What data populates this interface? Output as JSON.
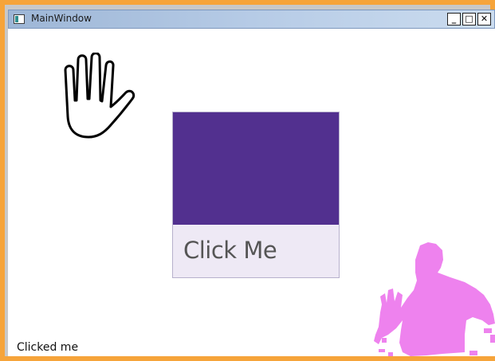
{
  "window": {
    "title": "MainWindow",
    "buttons": {
      "minimize": "_",
      "maximize": "□",
      "close": "✕"
    },
    "frame_color": "#f6a43a"
  },
  "main": {
    "tile": {
      "label": "Click Me",
      "accent_color": "#52308f"
    },
    "status_text": "Clicked me",
    "cursor_icon": "hand-cursor-icon",
    "user_silhouette_color": "#ee82ee"
  }
}
